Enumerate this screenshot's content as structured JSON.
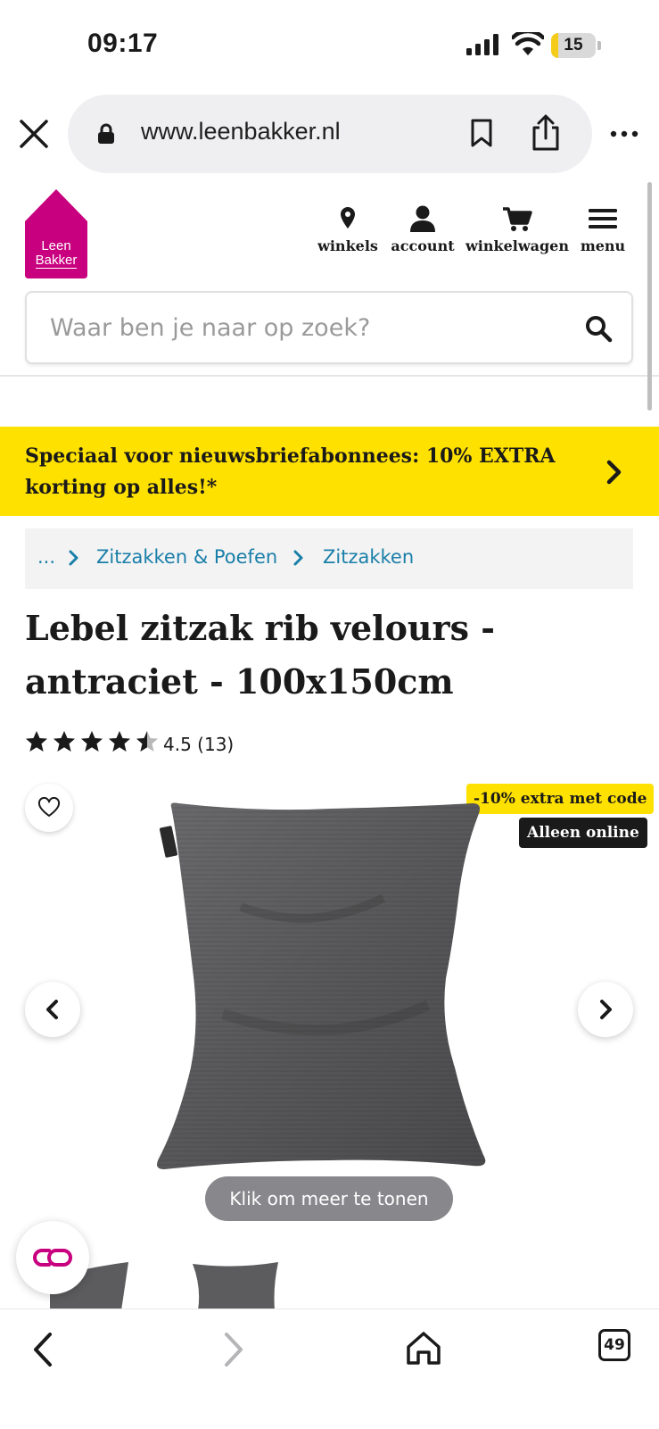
{
  "status_bar": {
    "time": "09:17",
    "battery_level": "15",
    "battery_fraction": 0.15
  },
  "browser": {
    "url": "www.leenbakker.nl",
    "tabs_count": "49",
    "icons": [
      "close-icon",
      "lock-icon",
      "bookmark-icon",
      "share-icon",
      "more-icon",
      "back-icon",
      "forward-icon",
      "home-icon",
      "tabs-icon"
    ]
  },
  "site": {
    "logo_line1": "Leen",
    "logo_line2": "Bakker",
    "brand_color": "#c8007f",
    "nav": [
      {
        "label": "winkels",
        "icon": "location-pin-icon"
      },
      {
        "label": "account",
        "icon": "user-icon"
      },
      {
        "label": "winkelwagen",
        "icon": "cart-icon"
      },
      {
        "label": "menu",
        "icon": "hamburger-icon"
      }
    ],
    "search_placeholder": "Waar ben je naar op zoek?"
  },
  "promo": {
    "text": "Speciaal voor nieuwsbriefabonnees: 10% EXTRA korting op alles!*",
    "color": "#ffe100"
  },
  "breadcrumb": [
    "...",
    "Zitzakken & Poefen",
    "Zitzakken"
  ],
  "product": {
    "title_line1": "Lebel zitzak rib velours -",
    "title_line2": "antraciet - 100x150cm",
    "rating_value": 4.5,
    "rating_text": "4.5 (13)",
    "badge_code": "-10% extra met code",
    "badge_online": "Alleen online",
    "toast": "Klik om meer te tonen"
  }
}
